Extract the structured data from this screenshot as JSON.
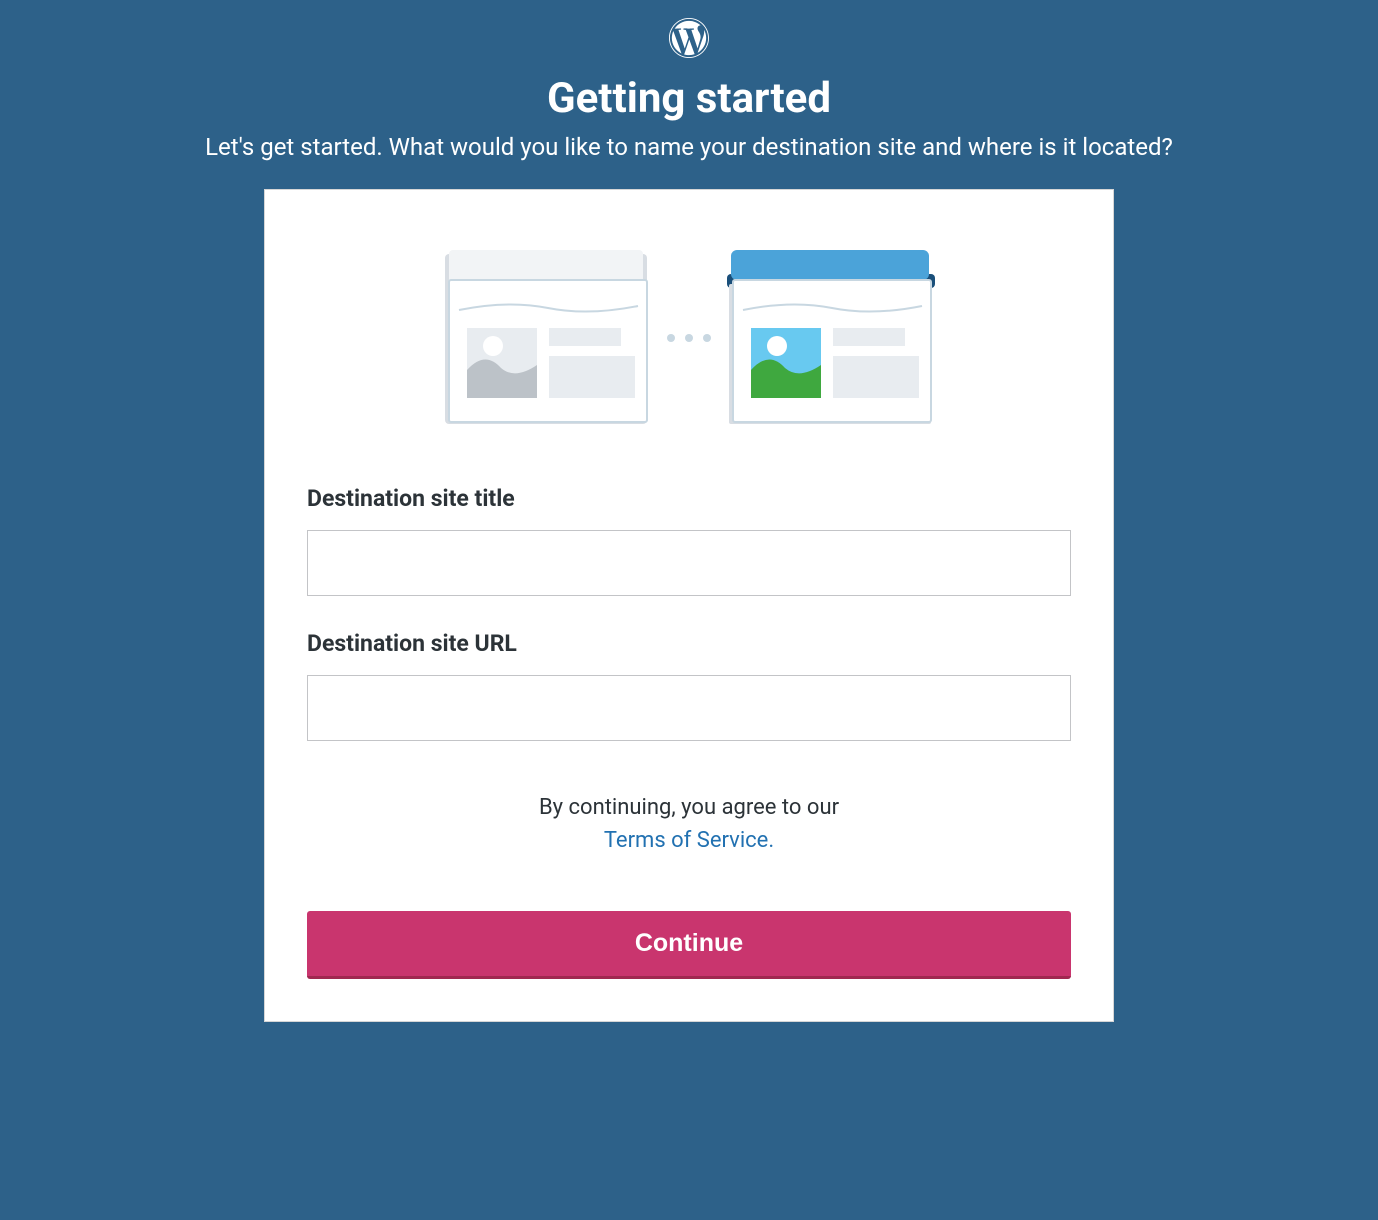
{
  "header": {
    "title": "Getting started",
    "subtitle": "Let's get started. What would you like to name your destination site and where is it located?"
  },
  "form": {
    "site_title": {
      "label": "Destination site title",
      "value": ""
    },
    "site_url": {
      "label": "Destination site URL",
      "value": ""
    }
  },
  "terms": {
    "prefix": "By continuing, you agree to our",
    "link_text": "Terms of Service."
  },
  "actions": {
    "continue_label": "Continue"
  },
  "colors": {
    "background": "#2d6189",
    "button_primary": "#c9356e",
    "link": "#2271b1"
  },
  "icons": {
    "logo": "wordpress-logo"
  }
}
